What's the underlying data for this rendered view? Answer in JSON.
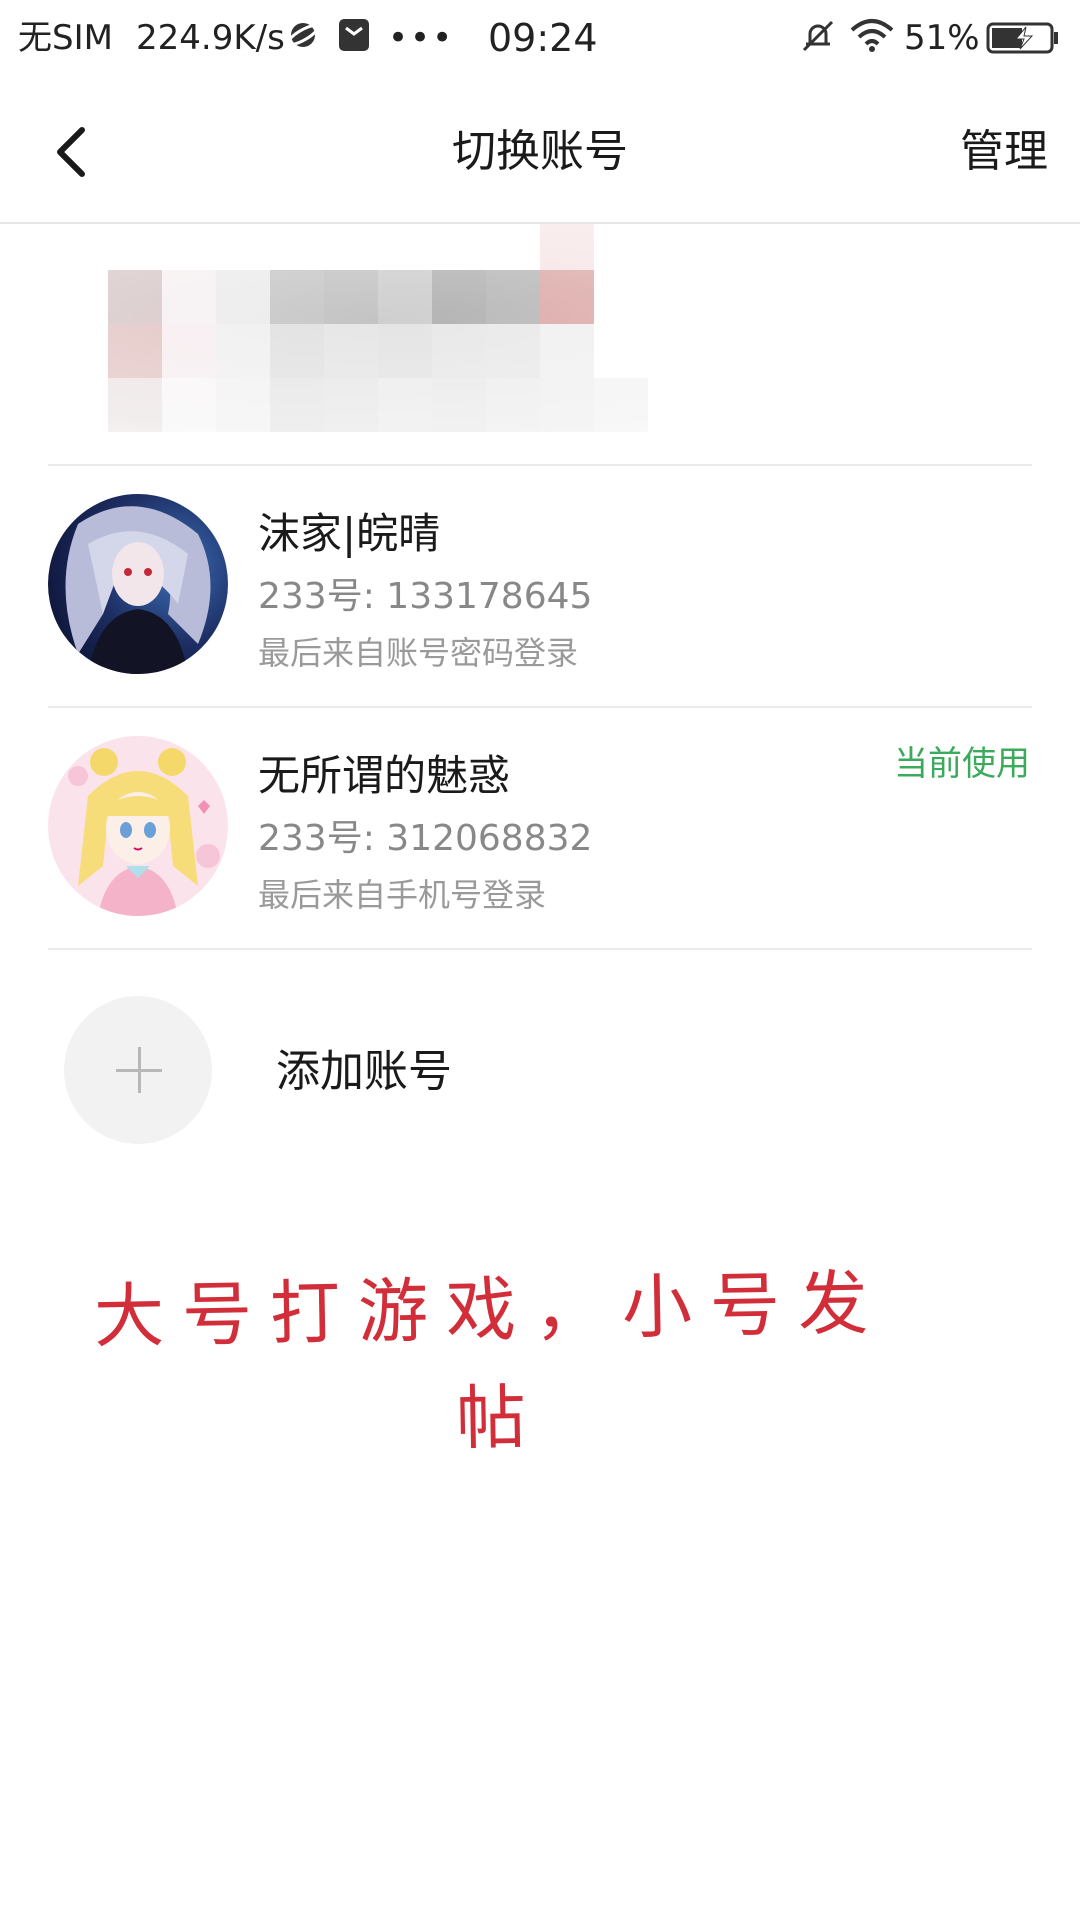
{
  "status_bar": {
    "carrier": "无SIM",
    "speed": "224.9K/s",
    "more": "•••",
    "time": "09:24",
    "battery_pct": "51%",
    "icons": [
      "planet-icon",
      "message-box-icon",
      "mute-bell-icon",
      "wifi-icon",
      "battery-charging-icon"
    ]
  },
  "nav": {
    "back_icon": "chevron-left-icon",
    "title": "切换账号",
    "manage": "管理"
  },
  "accounts": [
    {
      "name": "沫家|皖晴",
      "id": "233号: 133178645",
      "login": "最后来自账号密码登录",
      "status": ""
    },
    {
      "name": "无所谓的魅惑",
      "id": "233号: 312068832",
      "login": "最后来自手机号登录",
      "status": "当前使用"
    }
  ],
  "add_account": {
    "icon": "plus-icon",
    "label": "添加账号"
  },
  "note": {
    "line1": "大号打游戏，小号发",
    "line2": "帖",
    "color": "#d12e3a"
  },
  "colors": {
    "accent_green": "#3caa5c",
    "text_primary": "#1a1a1a",
    "text_secondary": "#888888",
    "divider": "#ebebeb"
  }
}
